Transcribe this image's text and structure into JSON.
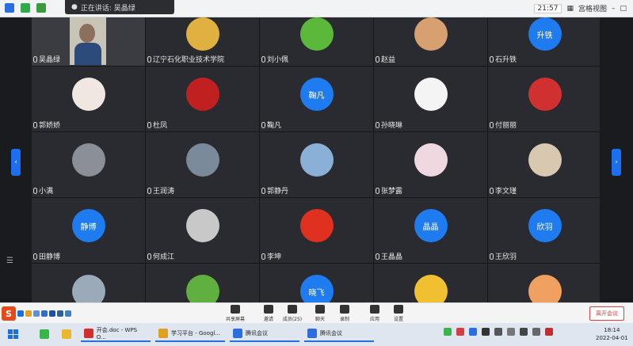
{
  "topbar": {
    "speaking_label": "正在讲话: 吴晶绿",
    "clock": "21:57",
    "view_label": "宫格视图"
  },
  "tiles": [
    {
      "name": "吴晶绿",
      "avatar_text": "",
      "color": "#5a6a80",
      "video": true
    },
    {
      "name": "辽宁石化职业技术学院",
      "avatar_text": "",
      "color": "#e0b040"
    },
    {
      "name": "刘小佩",
      "avatar_text": "",
      "color": "#5cb83a"
    },
    {
      "name": "赵益",
      "avatar_text": "",
      "color": "#d6a070"
    },
    {
      "name": "石升铁",
      "avatar_text": "升铁",
      "color": "#1f7cf0"
    },
    {
      "name": "郭娇娇",
      "avatar_text": "",
      "color": "#f0e8e0"
    },
    {
      "name": "杜凤",
      "avatar_text": "",
      "color": "#c02020"
    },
    {
      "name": "鞠凡",
      "avatar_text": "鞠凡",
      "color": "#1f7cf0"
    },
    {
      "name": "孙晓琳",
      "avatar_text": "",
      "color": "#f4f4f4"
    },
    {
      "name": "付丽丽",
      "avatar_text": "",
      "color": "#d03030"
    },
    {
      "name": "小满",
      "avatar_text": "",
      "color": "#8a8f98"
    },
    {
      "name": "王润涛",
      "avatar_text": "",
      "color": "#7a8a9a"
    },
    {
      "name": "郭静丹",
      "avatar_text": "",
      "color": "#8ab0d8"
    },
    {
      "name": "张梦露",
      "avatar_text": "",
      "color": "#f0d8e0"
    },
    {
      "name": "李文瑾",
      "avatar_text": "",
      "color": "#d8c8b0"
    },
    {
      "name": "田静博",
      "avatar_text": "静博",
      "color": "#1f7cf0"
    },
    {
      "name": "何成江",
      "avatar_text": "",
      "color": "#c8c8c8"
    },
    {
      "name": "李坤",
      "avatar_text": "",
      "color": "#e03020"
    },
    {
      "name": "王晶晶",
      "avatar_text": "晶晶",
      "color": "#1f7cf0"
    },
    {
      "name": "王欣羽",
      "avatar_text": "欣羽",
      "color": "#1f7cf0"
    },
    {
      "name": "",
      "avatar_text": "",
      "color": "#9aaab8"
    },
    {
      "name": "",
      "avatar_text": "",
      "color": "#60b040"
    },
    {
      "name": "",
      "avatar_text": "晓飞",
      "color": "#1f7cf0"
    },
    {
      "name": "",
      "avatar_text": "",
      "color": "#f0c030"
    },
    {
      "name": "",
      "avatar_text": "",
      "color": "#f0a060"
    }
  ],
  "toolbar": {
    "items": [
      "共享屏幕",
      "邀请",
      "成员(25)",
      "聊天",
      "录制",
      "应用",
      "设置"
    ],
    "end_label": "离开会议"
  },
  "taskbar": {
    "tasks": [
      "开会.doc - WPS O...",
      "学习平台 - Googl...",
      "腾讯会议",
      "腾讯会议"
    ],
    "time": "18:14",
    "date": "2022-04-01"
  }
}
